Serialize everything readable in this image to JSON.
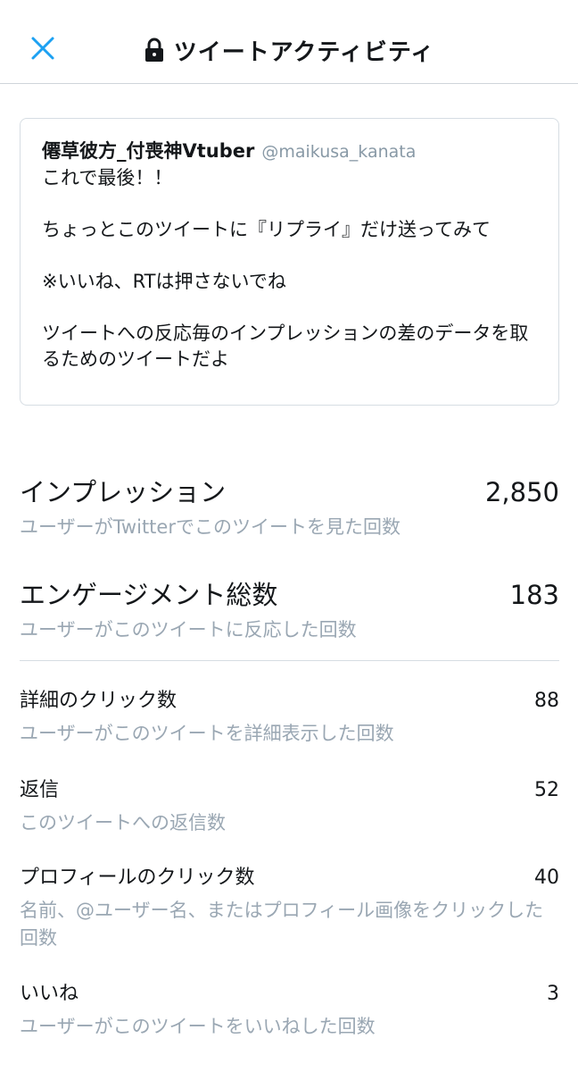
{
  "header": {
    "title": "ツイートアクティビティ",
    "close_icon": "close-x-icon",
    "lock_icon": "lock-icon",
    "accent_color": "#1da1f2"
  },
  "tweet": {
    "display_name": "僊草彼方_付喪神Vtuber",
    "handle": "@maikusa_kanata",
    "text": "これで最後！！\n\nちょっとこのツイートに『リプライ』だけ送ってみて\n\n※いいね、RTは押さないでね\n\nツイートへの反応毎のインプレッションの差のデータを取るためのツイートだよ"
  },
  "impressions": {
    "label": "インプレッション",
    "value": "2,850",
    "description": "ユーザーがTwitterでこのツイートを見た回数"
  },
  "engagements": {
    "label": "エンゲージメント総数",
    "value": "183",
    "description": "ユーザーがこのツイートに反応した回数"
  },
  "metrics": [
    {
      "label": "詳細のクリック数",
      "value": "88",
      "description": "ユーザーがこのツイートを詳細表示した回数"
    },
    {
      "label": "返信",
      "value": "52",
      "description": "このツイートへの返信数"
    },
    {
      "label": "プロフィールのクリック数",
      "value": "40",
      "description": "名前、@ユーザー名、またはプロフィール画像をクリックした回数"
    },
    {
      "label": "いいね",
      "value": "3",
      "description": "ユーザーがこのツイートをいいねした回数"
    }
  ]
}
